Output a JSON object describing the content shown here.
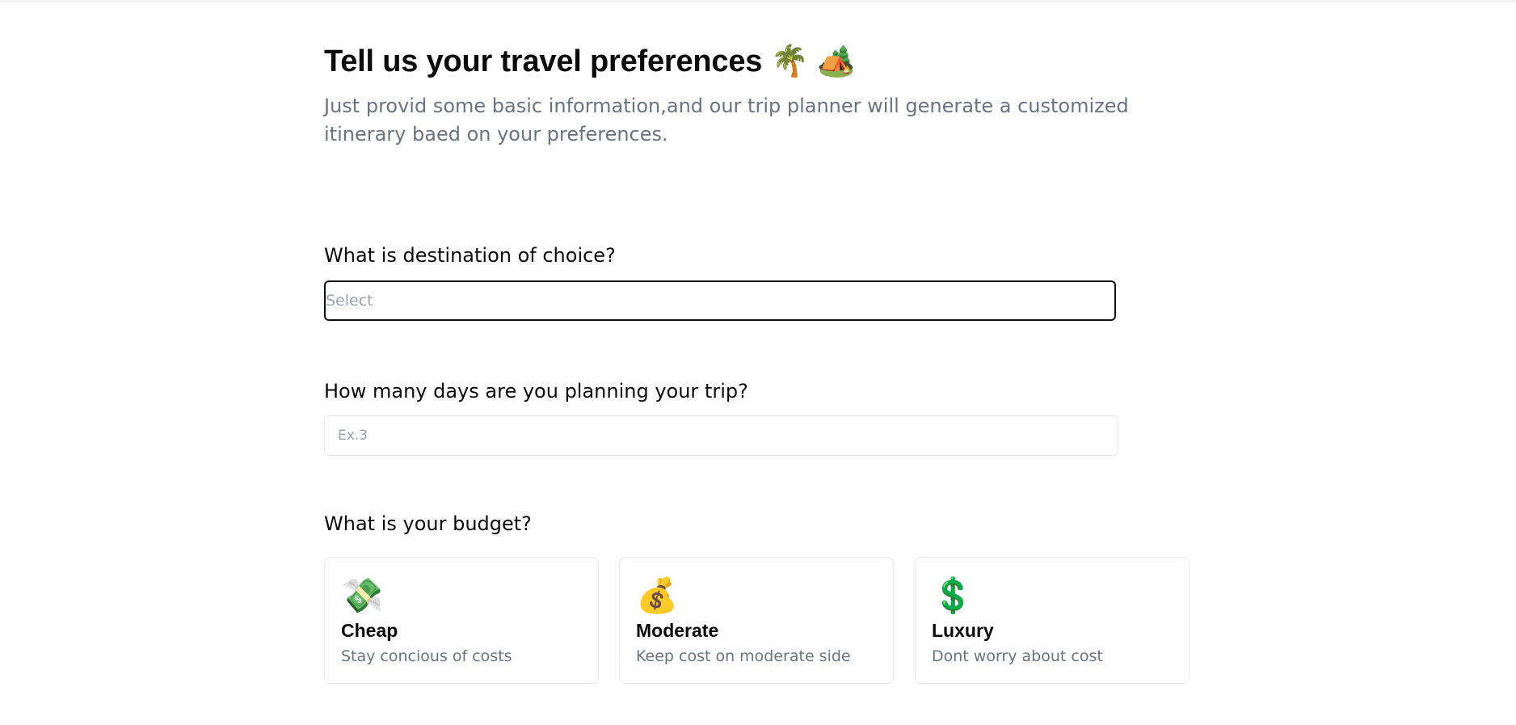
{
  "header": {
    "title": "Tell us your travel preferences",
    "title_emojis": "🌴 🏕️",
    "subtitle": "Just provid some basic information,and our trip planner will generate a customized itinerary baed on your preferences."
  },
  "destination": {
    "label": "What is destination of choice?",
    "placeholder": "Select"
  },
  "days": {
    "label": "How many days are you planning your trip?",
    "placeholder": "Ex.3"
  },
  "budget": {
    "label": "What is your budget?",
    "options": [
      {
        "icon": "💸",
        "icon_name": "money-with-wings-icon",
        "title": "Cheap",
        "desc": "Stay concious of costs"
      },
      {
        "icon": "💰",
        "icon_name": "money-bag-icon",
        "title": "Moderate",
        "desc": "Keep cost on moderate side"
      },
      {
        "icon": "💲",
        "icon_name": "dollar-sign-icon",
        "title": "Luxury",
        "desc": "Dont worry about cost"
      }
    ]
  }
}
